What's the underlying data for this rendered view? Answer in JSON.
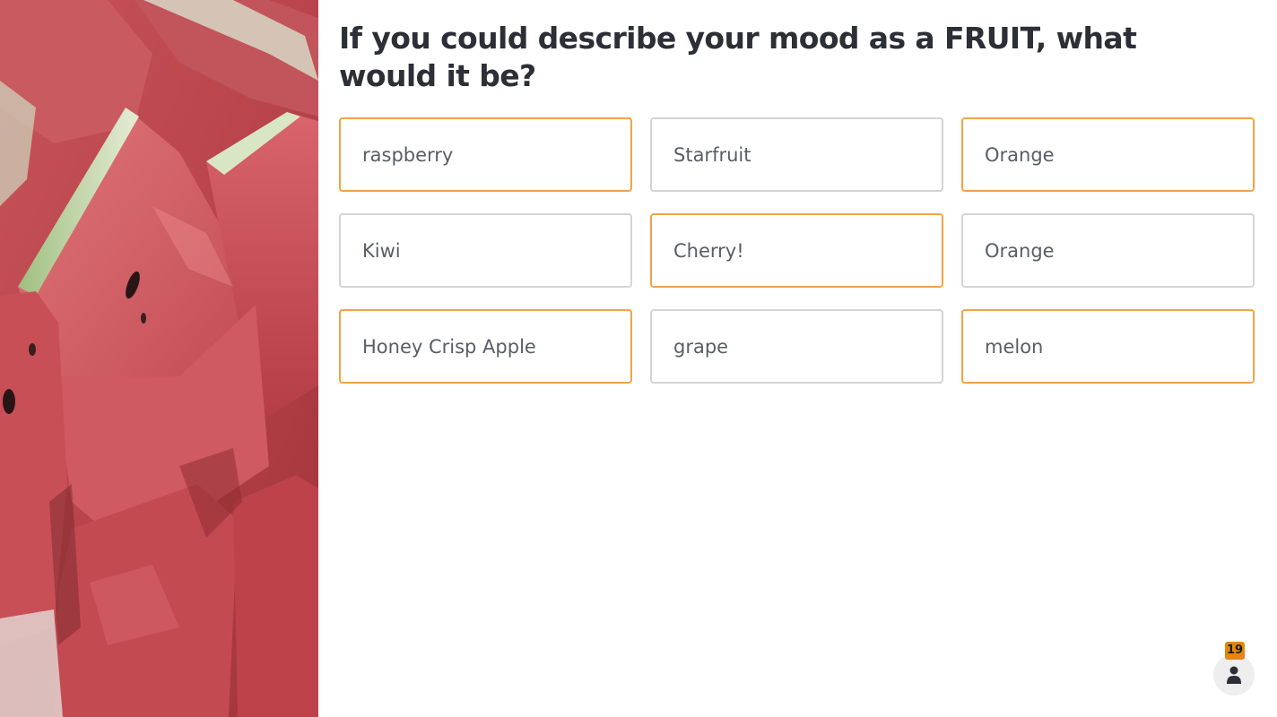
{
  "question": {
    "text": "If you could describe your mood as a FRUIT, what would it be?"
  },
  "responses": [
    {
      "label": "raspberry",
      "highlighted": true
    },
    {
      "label": "Starfruit",
      "highlighted": false
    },
    {
      "label": "Orange",
      "highlighted": true
    },
    {
      "label": "Kiwi",
      "highlighted": false
    },
    {
      "label": "Cherry!",
      "highlighted": true
    },
    {
      "label": "Orange",
      "highlighted": false
    },
    {
      "label": "Honey Crisp Apple",
      "highlighted": true
    },
    {
      "label": "grape",
      "highlighted": false
    },
    {
      "label": "melon",
      "highlighted": true
    }
  ],
  "participants": {
    "count": "19",
    "icon": "person-icon"
  },
  "colors": {
    "highlight_border": "#f2a24a",
    "default_border": "#d4d4d4",
    "badge": "#e5860f",
    "question_text": "#2c2f36"
  }
}
